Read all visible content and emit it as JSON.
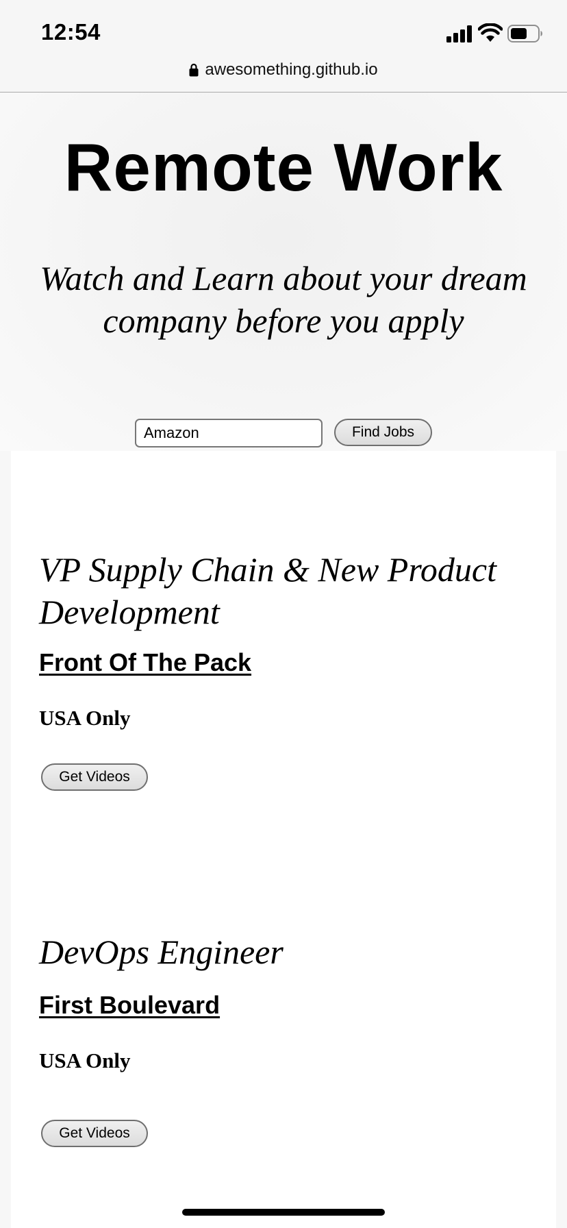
{
  "status_bar": {
    "time": "12:54",
    "icons": [
      "signal-icon",
      "wifi-icon",
      "battery-icon"
    ]
  },
  "browser": {
    "url": "awesomething.github.io",
    "lock_icon": "lock-icon"
  },
  "hero": {
    "title": "Remote Work",
    "tagline": "Watch and Learn about your dream company before you apply"
  },
  "search": {
    "value": "Amazon",
    "button_label": "Find Jobs"
  },
  "jobs": [
    {
      "title": "VP Supply Chain & New Product Development",
      "company": "Front Of The Pack",
      "location": "USA Only",
      "button_label": "Get Videos"
    },
    {
      "title": "DevOps Engineer",
      "company": "First Boulevard",
      "location": "USA Only",
      "button_label": "Get Videos"
    }
  ]
}
